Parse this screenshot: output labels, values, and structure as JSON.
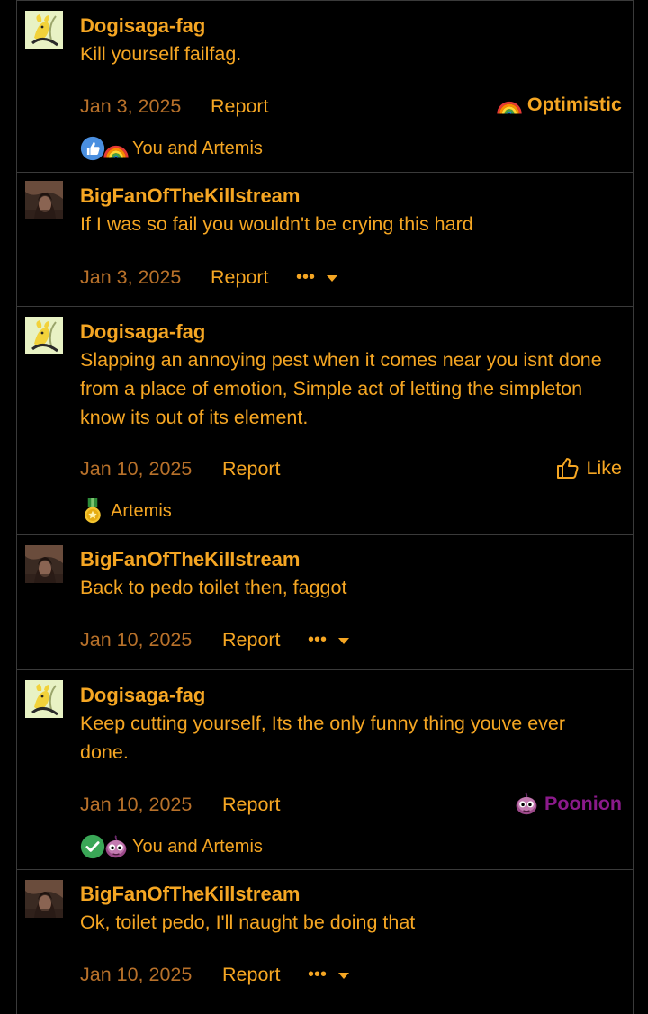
{
  "theme": {
    "accent": "#f5a623",
    "date_color": "#b8712a",
    "poonion_color": "#8b1a8b",
    "border": "#3a3a3a",
    "background": "#000000"
  },
  "posts": [
    {
      "author": "Dogisaga-fag",
      "text": "Kill yourself failfag.",
      "date": "Jan 3, 2025",
      "report": "Report",
      "reaction_label": "Optimistic",
      "reaction_icon": "rainbow-icon",
      "reactors": "You and Artemis",
      "reactor_icons": [
        "thumbs-up-icon",
        "rainbow-icon"
      ]
    },
    {
      "author": "BigFanOfTheKillstream",
      "text": "If I was so fail you wouldn't be crying this hard",
      "date": "Jan 3, 2025",
      "report": "Report",
      "more": "•••"
    },
    {
      "author": "Dogisaga-fag",
      "text": "Slapping an annoying pest when it comes near you isnt done from a place of emotion, Simple act of letting the simpleton know its out of its element.",
      "date": "Jan 10, 2025",
      "report": "Report",
      "like": "Like",
      "reactors": "Artemis",
      "reactor_icons": [
        "medal-icon"
      ]
    },
    {
      "author": "BigFanOfTheKillstream",
      "text": "Back to pedo toilet then, faggot",
      "date": "Jan 10, 2025",
      "report": "Report",
      "more": "•••"
    },
    {
      "author": "Dogisaga-fag",
      "text": "Keep cutting yourself, Its the only funny thing youve ever done.",
      "date": "Jan 10, 2025",
      "report": "Report",
      "reaction_label": "Poonion",
      "reaction_icon": "poonion-icon",
      "reactors": "You and Artemis",
      "reactor_icons": [
        "checkmark-icon",
        "poonion-icon"
      ]
    },
    {
      "author": "BigFanOfTheKillstream",
      "text": "Ok, toilet pedo, I'll naught be doing that",
      "date": "Jan 10, 2025",
      "report": "Report",
      "more": "•••"
    }
  ]
}
